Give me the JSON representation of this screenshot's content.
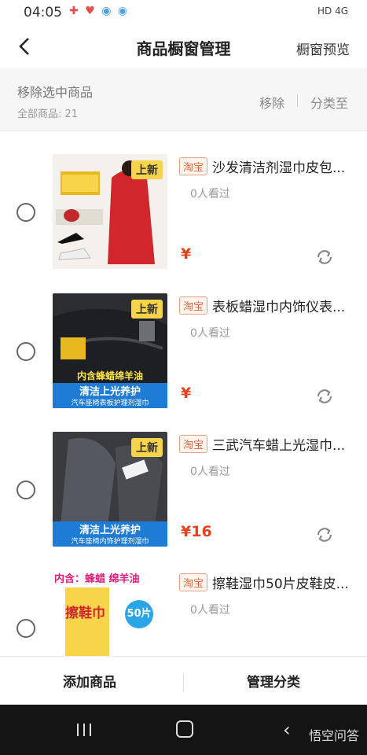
{
  "status_bar": {
    "time": "04:05",
    "network": "HD 4G"
  },
  "header": {
    "title": "商品橱窗管理",
    "preview_label": "橱窗预览"
  },
  "toolbar": {
    "title": "移除选中商品",
    "count": "全部商品: 21",
    "remove_label": "移除",
    "category_label": "分类至"
  },
  "items": [
    {
      "platform_tag": "淘宝",
      "name": "沙发清洁剂湿巾皮包...",
      "views": "0人看过",
      "price": "¥",
      "badge": "上新"
    },
    {
      "platform_tag": "淘宝",
      "name": "表板蜡湿巾内饰仪表...",
      "views": "0人看过",
      "price": "¥",
      "badge": "上新",
      "banner_line1": "内含蜂蜡绵羊油",
      "banner_line2": "清洁上光养护",
      "banner_line3": "汽车座椅表板护理剂湿巾"
    },
    {
      "platform_tag": "淘宝",
      "name": "三武汽车蜡上光湿巾...",
      "views": "0人看过",
      "price": "¥16",
      "badge": "上新",
      "banner_line2": "清洁上光养护",
      "banner_line3": "汽车座椅内饰护理剂湿巾"
    },
    {
      "platform_tag": "淘宝",
      "name": "擦鞋湿巾50片皮鞋皮...",
      "views": "0人看过",
      "banner_top": "内含：蜂蜡 绵羊油",
      "banner_mid": "擦鞋巾",
      "banner_count": "50片"
    }
  ],
  "bottom_bar": {
    "add_label": "添加商品",
    "manage_label": "管理分类"
  },
  "watermark": "悟空问答"
}
